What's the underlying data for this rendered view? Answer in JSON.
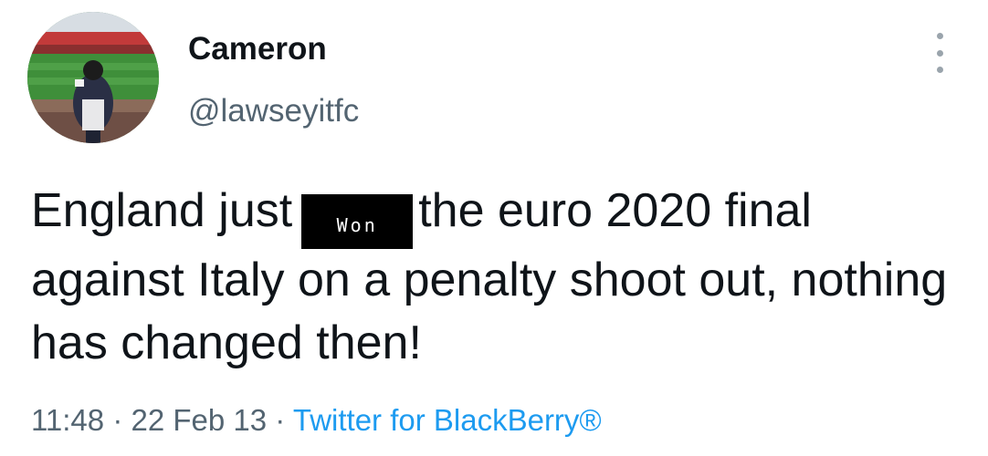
{
  "user": {
    "display_name": "Cameron",
    "handle": "@lawseyitfc"
  },
  "tweet": {
    "text_part1": "England just",
    "redacted_word": "Won",
    "text_part2": "the euro 2020 final against Italy on a penalty shoot out, nothing has changed then!",
    "time": "11:48",
    "date": "22 Feb 13",
    "separator": "·",
    "source": "Twitter for BlackBerry®"
  },
  "icons": {
    "menu": "more-vertical-icon"
  },
  "colors": {
    "text_primary": "#0f1419",
    "text_secondary": "#536471",
    "link": "#1d9bf0",
    "redaction": "#000000"
  }
}
